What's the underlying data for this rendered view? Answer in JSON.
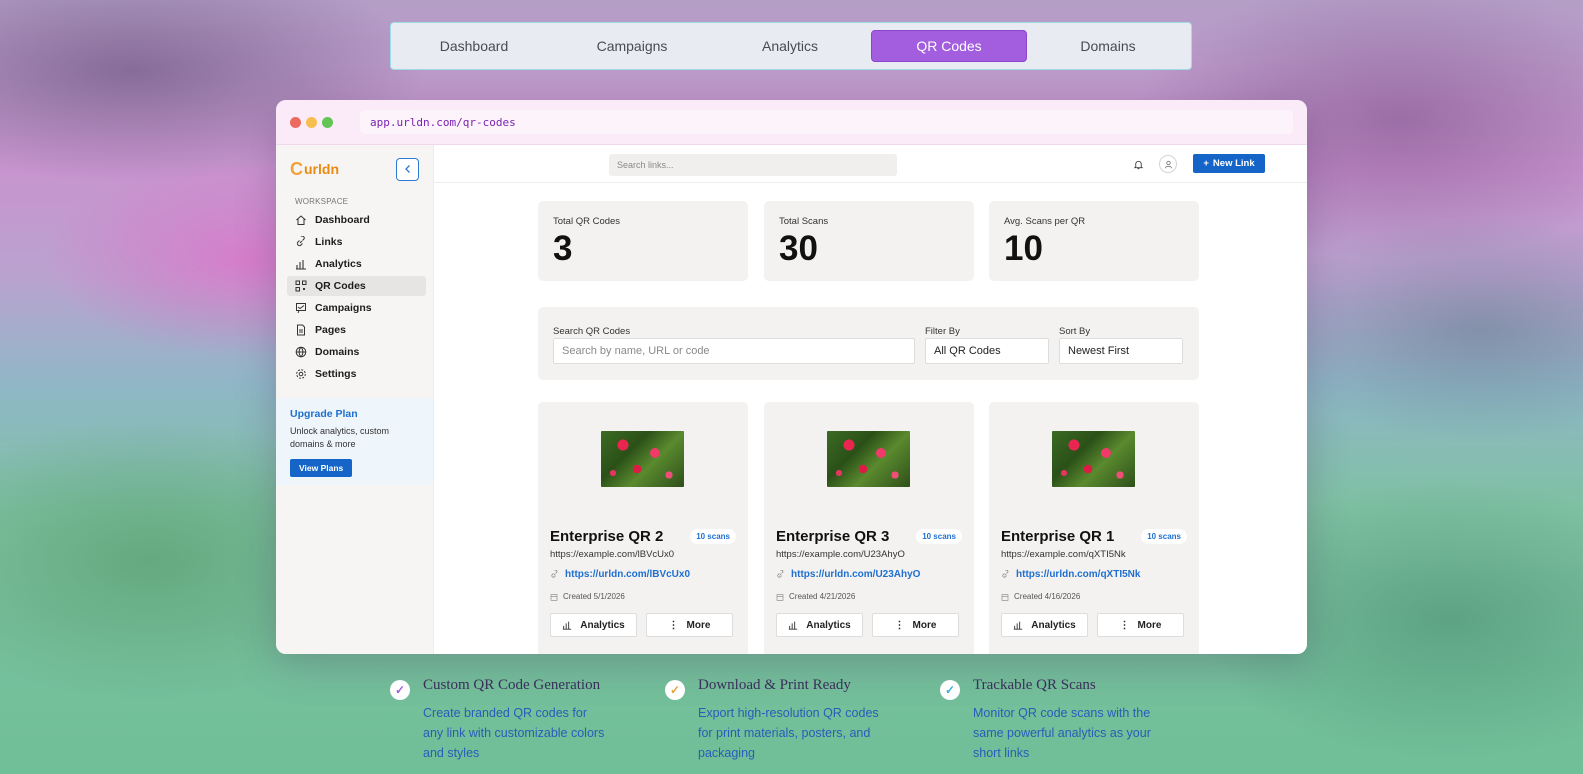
{
  "top_nav": {
    "tabs": [
      {
        "label": "Dashboard",
        "active": false
      },
      {
        "label": "Campaigns",
        "active": false
      },
      {
        "label": "Analytics",
        "active": false
      },
      {
        "label": "QR Codes",
        "active": true
      },
      {
        "label": "Domains",
        "active": false
      }
    ]
  },
  "browser": {
    "url": "app.urldn.com/qr-codes"
  },
  "sidebar": {
    "logo_text": "urldn",
    "workspace_label": "WORKSPACE",
    "items": [
      {
        "label": "Dashboard",
        "icon": "home-icon",
        "active": false
      },
      {
        "label": "Links",
        "icon": "link-icon",
        "active": false
      },
      {
        "label": "Analytics",
        "icon": "bar-chart-icon",
        "active": false
      },
      {
        "label": "QR Codes",
        "icon": "qr-code-icon",
        "active": true
      },
      {
        "label": "Campaigns",
        "icon": "campaign-icon",
        "active": false
      },
      {
        "label": "Pages",
        "icon": "page-icon",
        "active": false
      },
      {
        "label": "Domains",
        "icon": "globe-icon",
        "active": false
      },
      {
        "label": "Settings",
        "icon": "gear-icon",
        "active": false
      }
    ],
    "upgrade": {
      "title": "Upgrade Plan",
      "description": "Unlock analytics, custom domains & more",
      "button": "View Plans"
    }
  },
  "header": {
    "search_placeholder": "Search links...",
    "new_link_label": "New Link"
  },
  "stats": [
    {
      "label": "Total QR Codes",
      "value": "3"
    },
    {
      "label": "Total Scans",
      "value": "30"
    },
    {
      "label": "Avg. Scans per QR",
      "value": "10"
    }
  ],
  "filters": {
    "search_label": "Search QR Codes",
    "search_placeholder": "Search by name, URL or code",
    "filter_label": "Filter By",
    "filter_value": "All QR Codes",
    "sort_label": "Sort By",
    "sort_value": "Newest First"
  },
  "qr_cards": [
    {
      "name": "Enterprise QR 2",
      "scans": "10 scans",
      "destination": "https://example.com/lBVcUx0",
      "short_url": "https://urldn.com/lBVcUx0",
      "created": "Created 5/1/2026",
      "analytics_label": "Analytics",
      "more_label": "More"
    },
    {
      "name": "Enterprise QR 3",
      "scans": "10 scans",
      "destination": "https://example.com/U23AhyO",
      "short_url": "https://urldn.com/U23AhyO",
      "created": "Created 4/21/2026",
      "analytics_label": "Analytics",
      "more_label": "More"
    },
    {
      "name": "Enterprise QR 1",
      "scans": "10 scans",
      "destination": "https://example.com/qXTI5Nk",
      "short_url": "https://urldn.com/qXTI5Nk",
      "created": "Created 4/16/2026",
      "analytics_label": "Analytics",
      "more_label": "More"
    }
  ],
  "features": [
    {
      "title": "Custom QR Code Generation",
      "description": "Create branded QR codes for any link with customizable colors and styles",
      "check_color": "#a35ee0"
    },
    {
      "title": "Download & Print Ready",
      "description": "Export high-resolution QR codes for print materials, posters, and packaging",
      "check_color": "#e8a23a"
    },
    {
      "title": "Trackable QR Scans",
      "description": "Monitor QR code scans with the same powerful analytics as your short links",
      "check_color": "#3aaee0"
    }
  ]
}
